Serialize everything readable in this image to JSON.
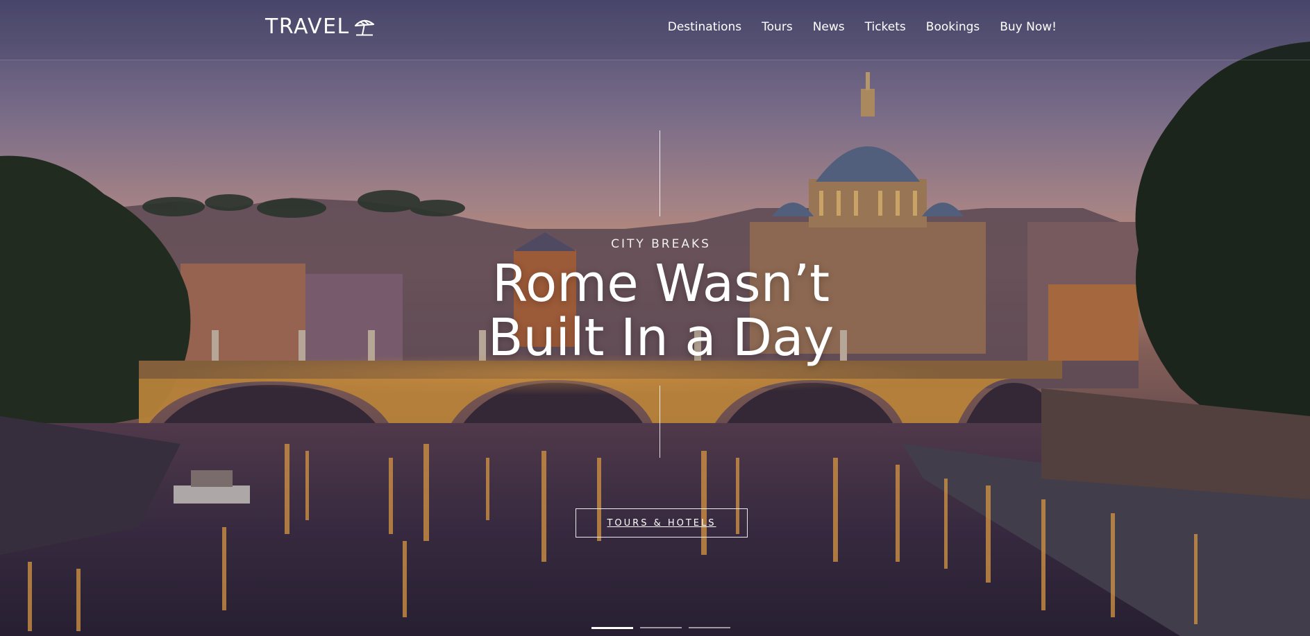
{
  "brand": {
    "name": "TRAVEL",
    "icon": "beach-umbrella-icon"
  },
  "nav": {
    "items": [
      {
        "label": "Destinations"
      },
      {
        "label": "Tours"
      },
      {
        "label": "News"
      },
      {
        "label": "Tickets"
      },
      {
        "label": "Bookings"
      },
      {
        "label": "Buy Now!"
      }
    ]
  },
  "hero": {
    "kicker": "CITY BREAKS",
    "headline_line1": "Rome Wasn’t",
    "headline_line2": "Built In a Day",
    "cta_label": "TOURS & HOTELS",
    "slides_count": 3,
    "active_slide": 1
  },
  "colors": {
    "sky_top": "#5a5a86",
    "sky_mid": "#a88aa0",
    "sky_horizon": "#e6a47a",
    "water": "#3a2c48",
    "light_glow": "#f6a83a",
    "text": "#ffffff"
  }
}
